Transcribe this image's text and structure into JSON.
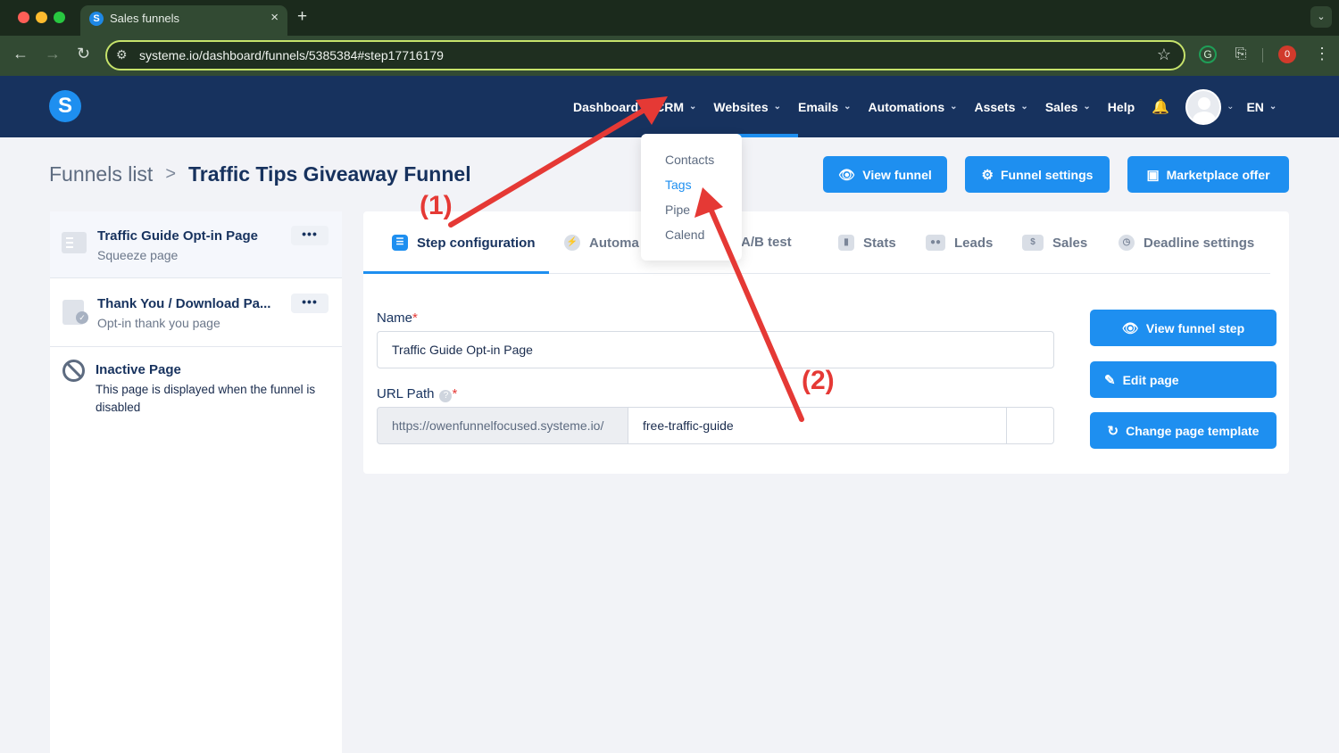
{
  "browser": {
    "tab_title": "Sales funnels",
    "tab_close": "×",
    "new_tab": "+",
    "url": "systeme.io/dashboard/funnels/5385384#step17716179",
    "extension_badge": "0"
  },
  "header": {
    "logo": "S",
    "nav": [
      {
        "label": "Dashboard"
      },
      {
        "label": "CRM"
      },
      {
        "label": "Websites"
      },
      {
        "label": "Emails"
      },
      {
        "label": "Automations"
      },
      {
        "label": "Assets"
      },
      {
        "label": "Sales"
      },
      {
        "label": "Help"
      }
    ],
    "language": "EN"
  },
  "crm_menu": {
    "items": [
      "Contacts",
      "Tags",
      "Pipe",
      "Calend"
    ]
  },
  "breadcrumb": {
    "parent": "Funnels list",
    "separator": ">",
    "current": "Traffic Tips Giveaway Funnel"
  },
  "actions": {
    "view_funnel": "View funnel",
    "funnel_settings": "Funnel settings",
    "marketplace_offer": "Marketplace offer"
  },
  "sidebar": {
    "items": [
      {
        "title": "Traffic Guide Opt-in Page",
        "subtitle": "Squeeze page",
        "more": "•••"
      },
      {
        "title": "Thank You / Download Pa...",
        "subtitle": "Opt-in thank you page",
        "more": "•••"
      },
      {
        "title": "Inactive Page",
        "subtitle_line1": "This page is displayed when the funnel is",
        "subtitle_line2": "disabled"
      }
    ]
  },
  "tabs": [
    {
      "label": "Step configuration"
    },
    {
      "label": "Automa"
    },
    {
      "label": "A/B test"
    },
    {
      "label": "Stats"
    },
    {
      "label": "Leads"
    },
    {
      "label": "Sales"
    },
    {
      "label": "Deadline settings"
    }
  ],
  "form": {
    "name_label": "Name",
    "name_value": "Traffic Guide Opt-in Page",
    "url_label": "URL Path",
    "url_help": "?",
    "required_mark": "*",
    "url_prefix": "https://owenfunnelfocused.systeme.io/",
    "url_value": "free-traffic-guide"
  },
  "step_actions": {
    "view_step": "View funnel step",
    "edit_page": "Edit page",
    "change_template": "Change page template"
  },
  "annotations": {
    "label1": "(1)",
    "label2": "(2)",
    "color": "#e53935"
  },
  "colors": {
    "header_bg": "#17325e",
    "accent": "#1e8ff0",
    "browser_bg": "#324a33"
  }
}
